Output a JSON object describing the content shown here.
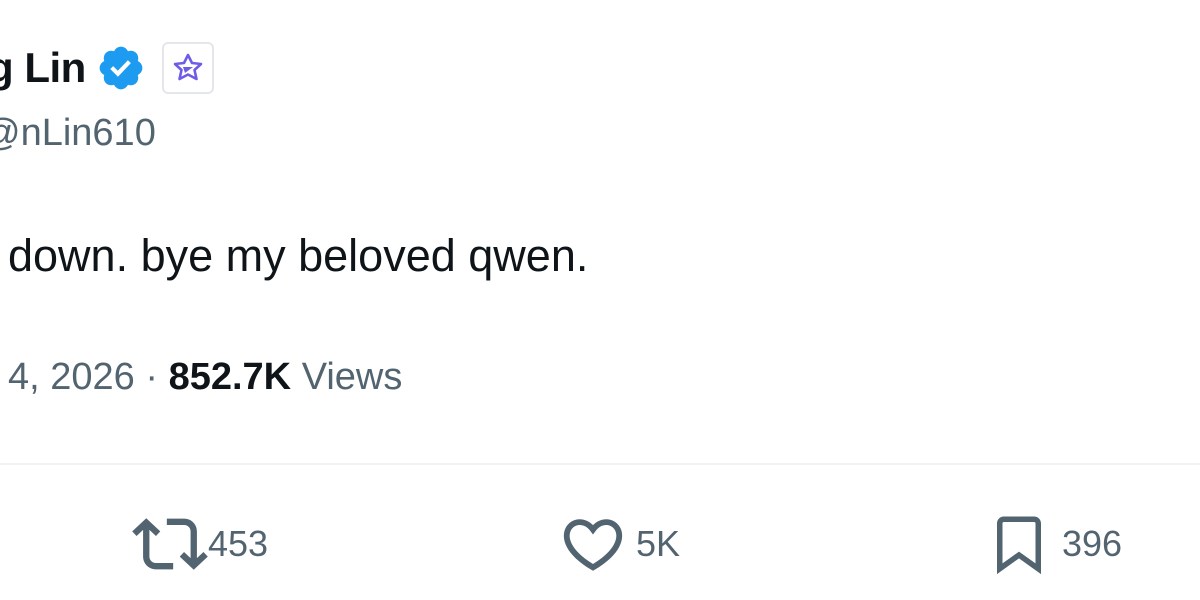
{
  "author": {
    "display_name": "g Lin",
    "handle": "nLin610",
    "verified_icon": "verified-badge-icon",
    "affiliate_icon": "qwen-logo-icon"
  },
  "tweet": {
    "text": "down. bye my beloved qwen.",
    "date": "4, 2026",
    "separator": "·",
    "views_count": "852.7K",
    "views_label": "Views"
  },
  "actions": {
    "retweet": {
      "icon": "retweet-icon",
      "count": "453"
    },
    "like": {
      "icon": "heart-icon",
      "count": "5K"
    },
    "bookmark": {
      "icon": "bookmark-icon",
      "count": "396"
    }
  },
  "colors": {
    "text_primary": "#0f1419",
    "text_secondary": "#536471",
    "verified_blue": "#1d9bf0",
    "divider": "#eff3f4",
    "badge_purple": "#6d5ce7"
  }
}
